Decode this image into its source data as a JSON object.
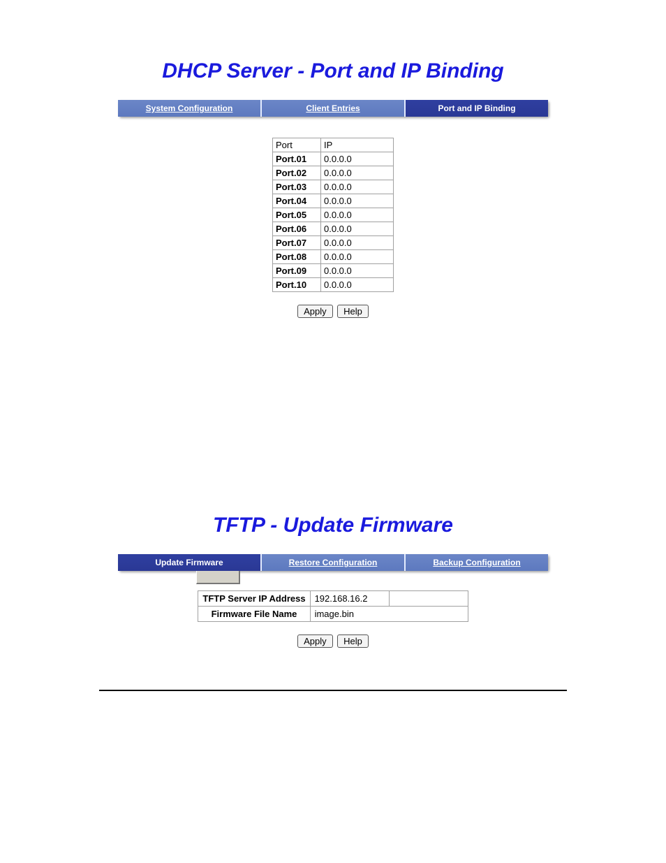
{
  "section1": {
    "title": "DHCP Server - Port and IP Binding",
    "tabs": [
      {
        "label": "System Configuration",
        "active": false
      },
      {
        "label": "Client Entries",
        "active": false
      },
      {
        "label": "Port and IP Binding",
        "active": true
      }
    ],
    "table": {
      "headers": {
        "port": "Port",
        "ip": "IP"
      },
      "rows": [
        {
          "port": "Port.01",
          "ip": "0.0.0.0"
        },
        {
          "port": "Port.02",
          "ip": "0.0.0.0"
        },
        {
          "port": "Port.03",
          "ip": "0.0.0.0"
        },
        {
          "port": "Port.04",
          "ip": "0.0.0.0"
        },
        {
          "port": "Port.05",
          "ip": "0.0.0.0"
        },
        {
          "port": "Port.06",
          "ip": "0.0.0.0"
        },
        {
          "port": "Port.07",
          "ip": "0.0.0.0"
        },
        {
          "port": "Port.08",
          "ip": "0.0.0.0"
        },
        {
          "port": "Port.09",
          "ip": "0.0.0.0"
        },
        {
          "port": "Port.10",
          "ip": "0.0.0.0"
        }
      ]
    },
    "buttons": {
      "apply": "Apply",
      "help": "Help"
    }
  },
  "section2": {
    "title": "TFTP - Update Firmware",
    "tabs": [
      {
        "label": "Update Firmware",
        "active": true
      },
      {
        "label": "Restore Configuration",
        "active": false
      },
      {
        "label": "Backup Configuration",
        "active": false
      }
    ],
    "fields": {
      "server_ip": {
        "label": "TFTP Server IP Address",
        "value": "192.168.16.2"
      },
      "file_name": {
        "label": "Firmware File Name",
        "value": "image.bin"
      }
    },
    "buttons": {
      "apply": "Apply",
      "help": "Help"
    }
  }
}
